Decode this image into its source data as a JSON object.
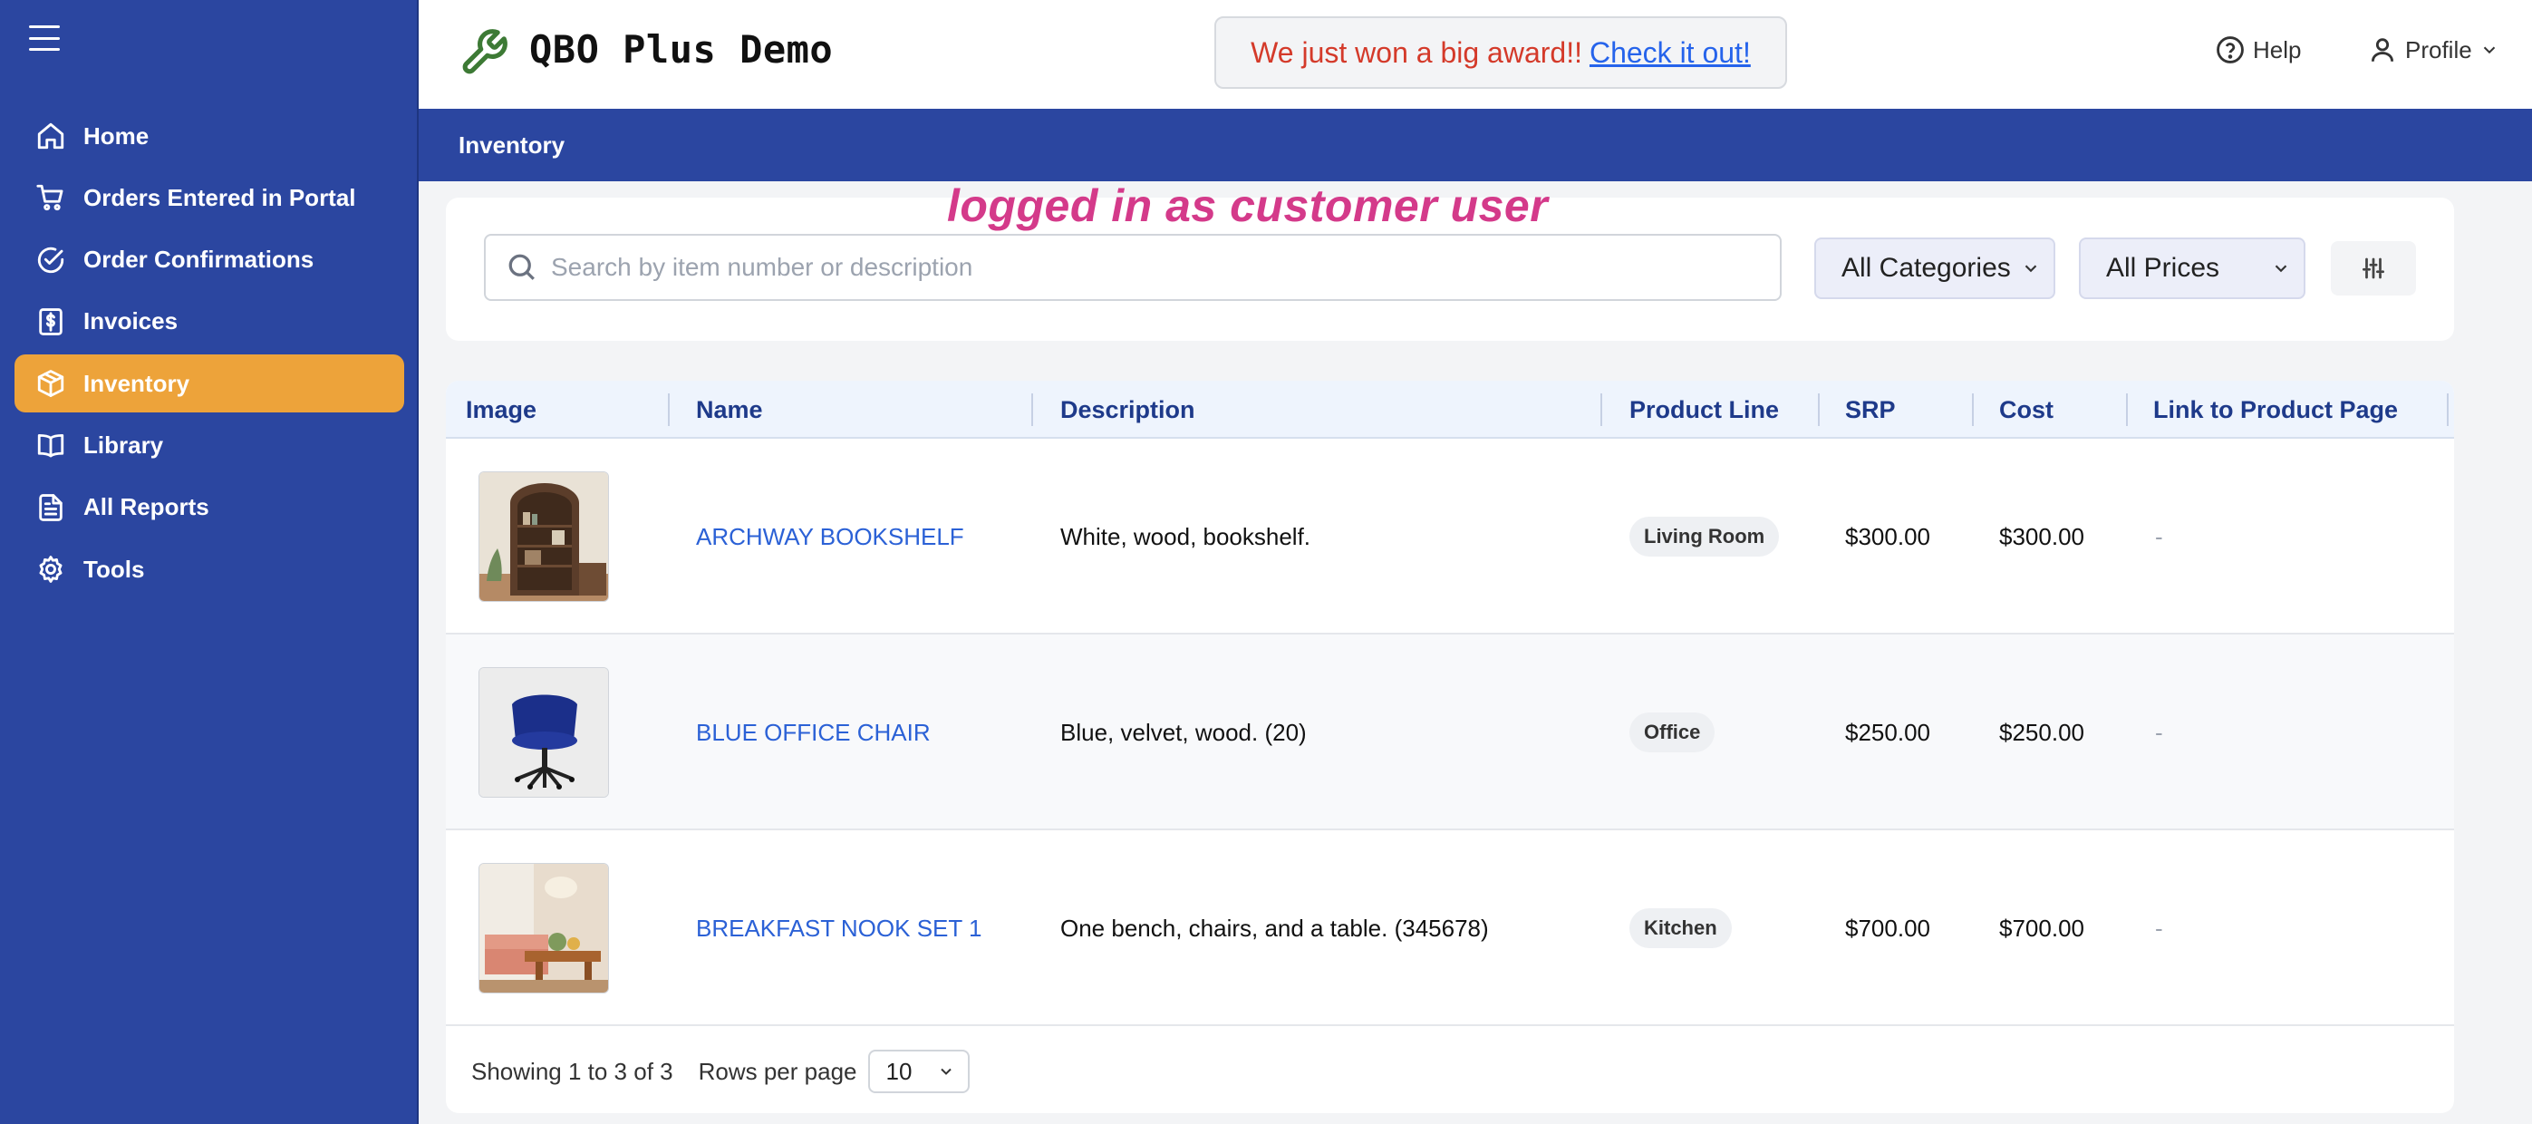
{
  "app": {
    "title": "QBO Plus Demo",
    "award_text": "We just won a big award!!",
    "award_link": "Check it out!",
    "help_label": "Help",
    "profile_label": "Profile"
  },
  "sidebar": {
    "items": [
      {
        "label": "Home",
        "icon": "home-icon"
      },
      {
        "label": "Orders Entered in Portal",
        "icon": "cart-icon"
      },
      {
        "label": "Order Confirmations",
        "icon": "check-circle-icon"
      },
      {
        "label": "Invoices",
        "icon": "dollar-document-icon"
      },
      {
        "label": "Inventory",
        "icon": "package-icon",
        "active": true
      },
      {
        "label": "Library",
        "icon": "book-icon"
      },
      {
        "label": "All Reports",
        "icon": "report-icon"
      },
      {
        "label": "Tools",
        "icon": "gear-icon"
      }
    ]
  },
  "page": {
    "title": "Inventory",
    "overlay_note": "logged in as customer user"
  },
  "filters": {
    "search_placeholder": "Search by item number or description",
    "category": "All Categories",
    "price": "All Prices"
  },
  "table": {
    "headers": [
      "Image",
      "Name",
      "Description",
      "Product Line",
      "SRP",
      "Cost",
      "Link to Product Page"
    ],
    "rows": [
      {
        "name": "ARCHWAY BOOKSHELF",
        "description": "White, wood, bookshelf.",
        "product_line": "Living Room",
        "srp": "$300.00",
        "cost": "$300.00",
        "link": "-"
      },
      {
        "name": "BLUE OFFICE CHAIR",
        "description": "Blue, velvet, wood. (20)",
        "product_line": "Office",
        "srp": "$250.00",
        "cost": "$250.00",
        "link": "-"
      },
      {
        "name": "BREAKFAST NOOK SET 1",
        "description": "One bench, chairs, and a table. (345678)",
        "product_line": "Kitchen",
        "srp": "$700.00",
        "cost": "$700.00",
        "link": "-"
      }
    ]
  },
  "pagination": {
    "showing": "Showing 1 to 3 of 3",
    "rows_per_page_label": "Rows per page",
    "rows_per_page": "10"
  },
  "colors": {
    "sidebar": "#2b46a0",
    "active_item": "#eda33a",
    "award_text": "#d43a2a",
    "link": "#2b61d6",
    "overlay": "#d43a8a"
  }
}
